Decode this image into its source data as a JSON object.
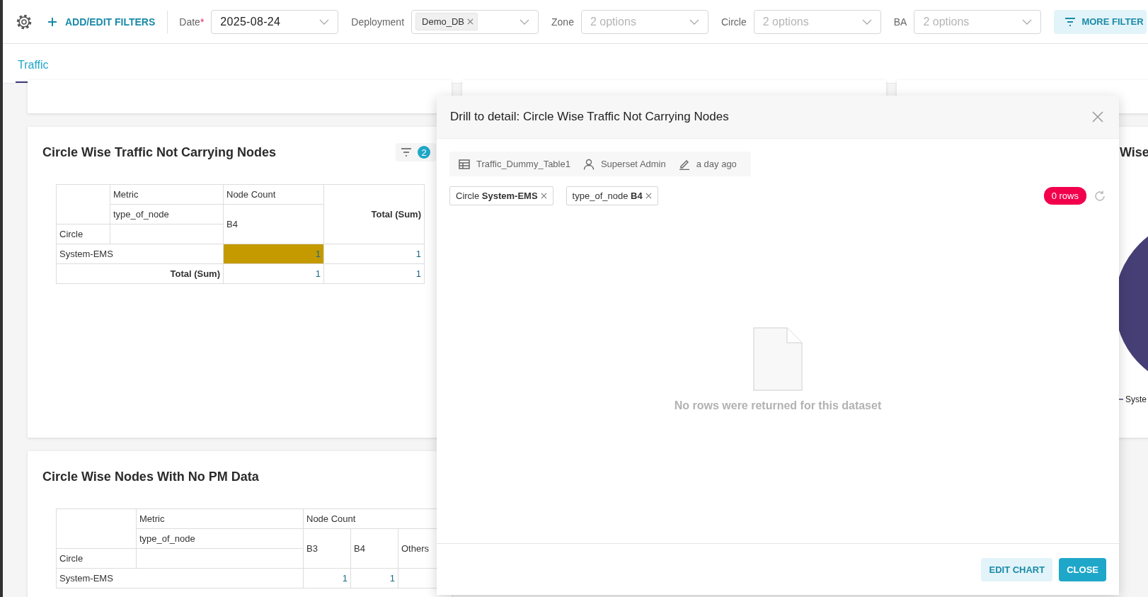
{
  "toolbar": {
    "add_filters": "ADD/EDIT FILTERS",
    "filters": [
      {
        "label": "Date",
        "required_mark": "*",
        "kind": "value",
        "value": "2025-08-24"
      },
      {
        "label": "Deployment",
        "kind": "tags",
        "tags": [
          "Demo_DB"
        ]
      },
      {
        "label": "Zone",
        "kind": "placeholder",
        "placeholder": "2 options"
      },
      {
        "label": "Circle",
        "kind": "placeholder",
        "placeholder": "2 options"
      },
      {
        "label": "BA",
        "kind": "placeholder",
        "placeholder": "2 options"
      }
    ],
    "more_filters": "MORE FILTER"
  },
  "tabs": [
    {
      "label": "Traffic",
      "selected": true
    }
  ],
  "charts": [
    {
      "title": "Circle Wise Traffic Not Carrying Nodes",
      "filter_count": "2",
      "pivot": {
        "metric_label": "Metric",
        "column_label": "type_of_node",
        "row_label": "Circle",
        "measure": "Node Count",
        "columns": [
          "B4"
        ],
        "total_label": "Total (Sum)",
        "rows": [
          {
            "name": "System-EMS",
            "values": [
              {
                "text": "1",
                "color": "#c49a00"
              }
            ],
            "total": "1"
          }
        ],
        "total_row_label": "Total (Sum)",
        "totals": [
          "1"
        ],
        "grand_total": "1"
      }
    },
    {
      "title": "Circle Wise Nodes With No PM Data",
      "pivot": {
        "metric_label": "Metric",
        "column_label": "type_of_node",
        "row_label": "Circle",
        "measure": "Node Count",
        "columns": [
          "B3",
          "B4",
          "Others"
        ],
        "rows": [
          {
            "name": "System-EMS",
            "values": [
              {
                "text": "1"
              },
              {
                "text": "1"
              }
            ]
          }
        ]
      }
    }
  ],
  "side_chart": {
    "title": "Wise",
    "legend": "Syste"
  },
  "modal": {
    "title": "Drill to detail: Circle Wise Traffic Not Carrying Nodes",
    "meta": [
      {
        "kind": "dataset",
        "text": "Traffic_Dummy_Table1"
      },
      {
        "kind": "owner",
        "text": "Superset Admin"
      },
      {
        "kind": "modified",
        "text": "a day ago"
      }
    ],
    "filters": [
      "Circle **System-EMS**",
      "type_of_node **B4**"
    ],
    "row_count": "0 rows",
    "empty_message": "No rows were returned for this dataset",
    "buttons": [
      {
        "label": "EDIT CHART",
        "kind": "secondary"
      },
      {
        "label": "CLOSE",
        "kind": "primary"
      }
    ]
  }
}
